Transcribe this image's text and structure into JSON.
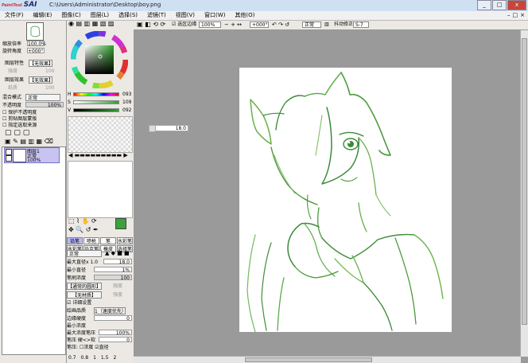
{
  "window": {
    "app_logo": "SAI",
    "app_logo_small": "PaintTool",
    "path": "C:\\Users\\Administrator\\Desktop\\boy.png",
    "controls": [
      "_",
      "□",
      "x"
    ]
  },
  "menubar": {
    "items": [
      "文件(F)",
      "编辑(E)",
      "图像(C)",
      "图层(L)",
      "选择(S)",
      "滤镜(T)",
      "视图(V)",
      "窗口(W)",
      "其他(O)"
    ],
    "right_controls": [
      "–",
      "□",
      "×"
    ]
  },
  "navigator": {
    "zoom_label": "缩放倍率",
    "zoom_value": "100.0%",
    "rotate_label": "旋转角度",
    "rotate_value": "+000°"
  },
  "layer_props": {
    "blend_label": "图层特性",
    "blend_value": "【无效果】",
    "blend_sub1": "强度",
    "blend_sub2": "100",
    "effect_label": "图层效果",
    "effect_value": "【无效果】",
    "effect_sub1": "纸质",
    "effect_sub2": "100",
    "mode_label": "混合模式",
    "mode_value": "正常",
    "opacity_label": "不透明度",
    "opacity_value": "100%",
    "cb1": "保护不透明度",
    "cb2": "剪贴图层蒙版",
    "cb3": "指定选取来源",
    "layer_name": "图层1",
    "layer_mode": "正常",
    "layer_opacity": "100%"
  },
  "color": {
    "h_value": "093",
    "s_value": "109",
    "v_value": "092",
    "fg_color": "#3aa33a",
    "bg_color": "#ffffff"
  },
  "tools": {
    "tiles": [
      "铅笔",
      "喷枪",
      "笔",
      "水彩笔",
      "水彩笔",
      "马克笔",
      "橡皮",
      "选择笔",
      "选择擦",
      "",
      "",
      ""
    ],
    "mode": "正常",
    "size_label": "最大直径",
    "size_mult": "x 1.0",
    "size_value": "18.0",
    "min_label": "最小直径",
    "min_value": "1%",
    "density_label": "笔刷浓度",
    "density_value": "100",
    "shape_value": "【通常的圆形】",
    "shape_sub": "强度",
    "texture_value": "【无材质】",
    "texture_sub": "强度",
    "cb_advanced": "详细设置",
    "quality_label": "绘画品质",
    "quality_value": "1（速度优先）",
    "edge_label": "边缘硬度",
    "edge_value": "0",
    "min_density_label": "最小浓度",
    "max_press_label": "最大浓度笔压",
    "max_press_value": "100%",
    "press_label": "笔压 硬<>软",
    "press_value": "0",
    "press2_label": "笔压:",
    "press2_a": "浓度",
    "press2_b": "直径",
    "sizes": [
      "0.7",
      "0.8",
      "1",
      "1.5",
      "2"
    ]
  },
  "canvas_toolbar": {
    "cb_label": "选区边缘",
    "zoom": "100%",
    "rotate": "+000°",
    "mode": "正常",
    "stab_label": "抖动修正",
    "stab_value": "S-7"
  },
  "tooltip": {
    "value": "18.0"
  }
}
